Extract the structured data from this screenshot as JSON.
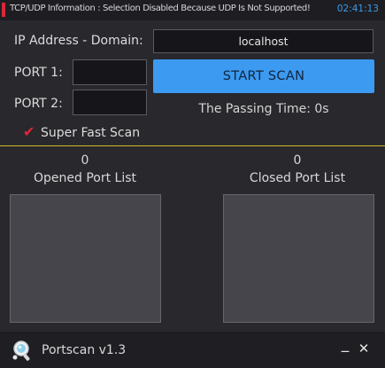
{
  "topbar": {
    "info": "TCP/UDP Information : Selection Disabled Because UDP Is Not Supported!",
    "clock": "02:41:13",
    "accent_color": "#d8283b",
    "clock_color": "#3d9be9"
  },
  "form": {
    "ip_label": "IP Address - Domain:",
    "host_value": "localhost",
    "port1_label": "PORT 1:",
    "port1_value": "",
    "port2_label": "PORT 2:",
    "port2_value": "",
    "start_button": "START SCAN",
    "passing_time": "The Passing Time: 0s",
    "super_fast_label": "Super Fast Scan",
    "super_fast_checked": true
  },
  "lists": {
    "opened_count": "0",
    "opened_title": "Opened Port List",
    "closed_count": "0",
    "closed_title": "Closed Port List"
  },
  "footer": {
    "app_title": "Portscan v1.3",
    "minimize": "_",
    "close": "✕",
    "icon": "magnifier-app-icon"
  },
  "colors": {
    "background": "#28282d",
    "button": "#3c9af0",
    "divider": "#d1b92a"
  }
}
